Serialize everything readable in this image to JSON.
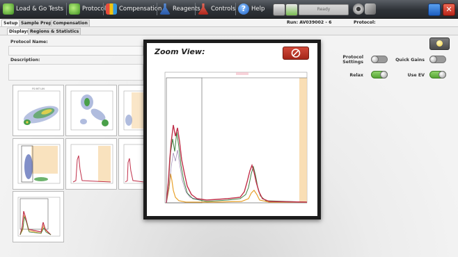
{
  "toolbar": {
    "items": [
      {
        "label": "Load & Go Tests"
      },
      {
        "label": "Protocol"
      },
      {
        "label": "Compensation"
      },
      {
        "label": "Reagents"
      },
      {
        "label": "Controls"
      },
      {
        "label": "Help"
      }
    ],
    "status": "Ready"
  },
  "tabs": {
    "top": [
      "Setup",
      "Sample Prep",
      "Compensation"
    ],
    "sub": [
      "Displays",
      "Regions & Statistics"
    ]
  },
  "run_info": {
    "run": "Run: AV039002 - 6",
    "protocol": "Protocol:"
  },
  "fields": {
    "protocol_name": "Protocol Name:",
    "description": "Description:"
  },
  "zoom": {
    "title": "Zoom View:"
  },
  "controls": {
    "protocol_settings": "Protocol Settings",
    "quick_gains": "Quick Gains",
    "relax": "Relax",
    "use_ev": "Use EV"
  },
  "toggles": {
    "protocol_settings": "off",
    "quick_gains": "off",
    "relax": "on",
    "use_ev": "on"
  },
  "colors": {
    "accent_green": "#56a534",
    "close_red": "#c0392b",
    "gate_orange": "#f7d6a3",
    "trace_red": "#c0304a",
    "trace_green": "#3f7f3f",
    "trace_orange": "#e8a12a"
  },
  "icons": [
    "load-go-icon",
    "protocol-icon",
    "compensation-icon",
    "reagents-icon",
    "controls-icon",
    "help-icon",
    "print-icon",
    "save-icon",
    "gear-icon",
    "minimize-icon",
    "close-icon",
    "no-entry-icon",
    "lightbulb-icon"
  ]
}
